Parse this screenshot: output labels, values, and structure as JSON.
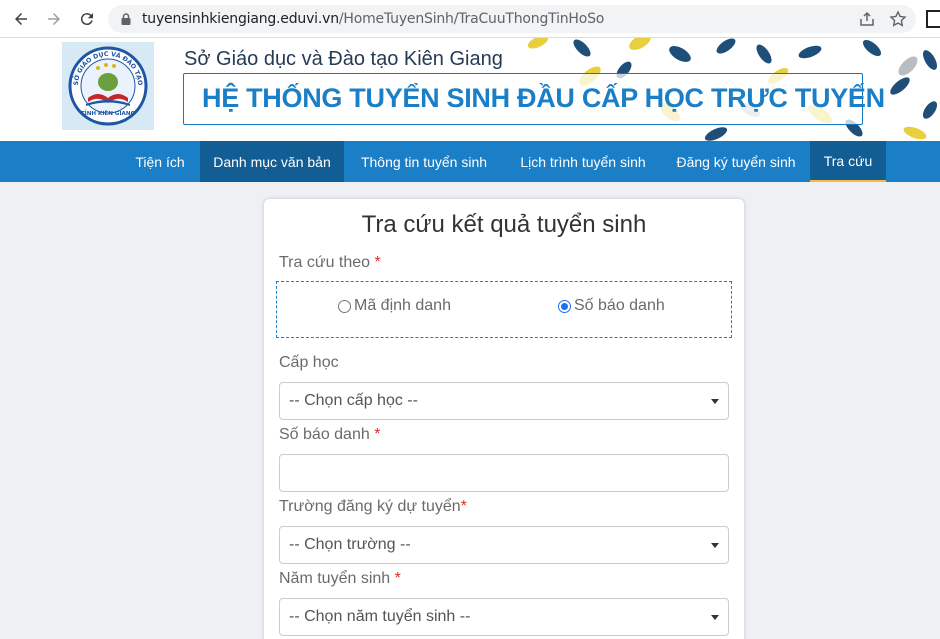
{
  "browser": {
    "url_host": "tuyensinhkiengiang.eduvi.vn",
    "url_path": "/HomeTuyenSinh/TraCuuThongTinHoSo",
    "icons": [
      "back-icon",
      "forward-icon",
      "reload-icon",
      "lock-icon",
      "share-icon",
      "star-icon"
    ]
  },
  "banner": {
    "department": "Sở Giáo dục và Đào tạo Kiên Giang",
    "system_title": "HỆ THỐNG TUYỂN SINH ĐẦU CẤP HỌC TRỰC TUYẾN",
    "logo_text_top": "SỞ GIÁO DỤC VÀ ĐÀO TẠO",
    "logo_text_bottom": "TỈNH KIÊN GIANG",
    "colors": {
      "primary": "#1a7fc6",
      "leaf_yellow": "#e7cf3f",
      "leaf_navy": "#1f4e79"
    }
  },
  "menu": {
    "items": [
      {
        "label": "Tiện ích"
      },
      {
        "label": "Danh mục văn bản"
      },
      {
        "label": "Thông tin tuyển sinh"
      },
      {
        "label": "Lịch trình tuyển sinh"
      },
      {
        "label": "Đăng ký tuyển sinh"
      },
      {
        "label": "Tra cứu"
      }
    ],
    "active_index": 5,
    "active_underline_color": "#f4b942"
  },
  "form": {
    "title": "Tra cứu kết quả tuyển sinh",
    "lookup_by_label": "Tra cứu theo",
    "required_mark": "*",
    "radio_options": [
      {
        "label": "Mã định danh",
        "checked": false
      },
      {
        "label": "Số báo danh",
        "checked": true
      }
    ],
    "level_label": "Cấp học",
    "level_placeholder": "-- Chọn cấp học --",
    "candidate_label": "Số báo danh",
    "candidate_value": "",
    "school_label": "Trường đăng ký dự tuyển",
    "school_placeholder": "-- Chọn trường --",
    "year_label": "Năm tuyển sinh",
    "year_placeholder": "-- Chọn năm tuyển sinh --"
  }
}
